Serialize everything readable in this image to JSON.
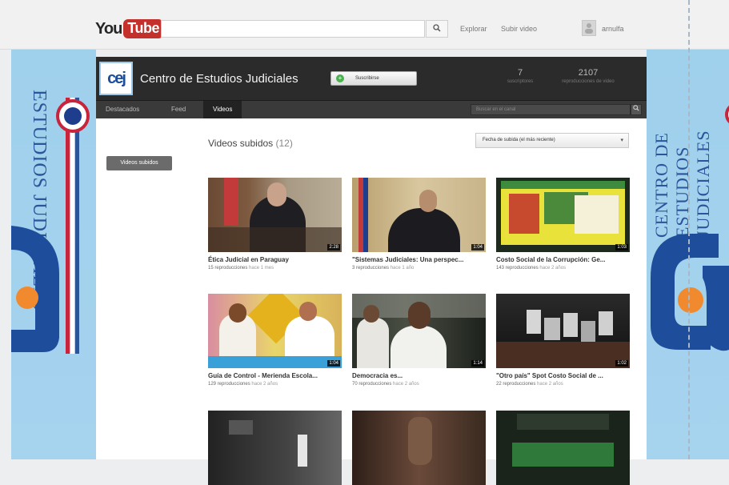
{
  "masthead": {
    "logo_you": "You",
    "logo_tube": "Tube",
    "search_placeholder": "",
    "search_icon": "search-icon",
    "links": [
      "Explorar",
      "Subir video"
    ],
    "user_name": "arnulfa"
  },
  "channel": {
    "logo_text": "cej",
    "title": "Centro de Estudios Judiciales",
    "subscribe_label": "Suscribirse",
    "stats": [
      {
        "value": "7",
        "label": "suscriptores"
      },
      {
        "value": "2107",
        "label": "reproducciones de video"
      }
    ],
    "tabs": [
      "Destacados",
      "Feed",
      "Videos"
    ],
    "active_tab": "Videos",
    "search_placeholder": "Buscar en el canal",
    "sidebar_button": "Videos subidos",
    "section_title": "Videos subidos",
    "section_count": "(12)",
    "sort_label": "Fecha de subida (el más reciente)",
    "videos": [
      {
        "title": "Ética Judicial en Paraguay",
        "views": "15 reproducciones",
        "age": "hace 1 mes",
        "duration": "2:28"
      },
      {
        "title": "\"Sistemas Judiciales: Una perspec...",
        "views": "3 reproducciones",
        "age": "hace 1 año",
        "duration": "1:04"
      },
      {
        "title": "Costo Social de la Corrupción: Ge...",
        "views": "143 reproducciones",
        "age": "hace 2 años",
        "duration": "1:03"
      },
      {
        "title": "Guía de Control - Merienda Escola...",
        "views": "129 reproducciones",
        "age": "hace 2 años",
        "duration": "1:04"
      },
      {
        "title": "Democracia es...",
        "views": "70 reproducciones",
        "age": "hace 2 años",
        "duration": "1:14"
      },
      {
        "title": "\"Otro país\" Spot Costo Social de ...",
        "views": "22 reproducciones",
        "age": "hace 2 años",
        "duration": "1:02"
      },
      {
        "title": "",
        "views": "",
        "age": "",
        "duration": ""
      },
      {
        "title": "",
        "views": "",
        "age": "",
        "duration": ""
      },
      {
        "title": "",
        "views": "",
        "age": "",
        "duration": ""
      }
    ]
  },
  "branding": {
    "left_text": "ESTUDIOS JUDICIALES",
    "right_text": "CENTRO DE ESTUDIOS JUDICIALES",
    "mark": "cej"
  },
  "colors": {
    "brand_blue": "#1e4d9c",
    "background_sky": "#a3d2ed",
    "header_dark": "#2b2b2b",
    "youtube_red": "#c4302b"
  }
}
